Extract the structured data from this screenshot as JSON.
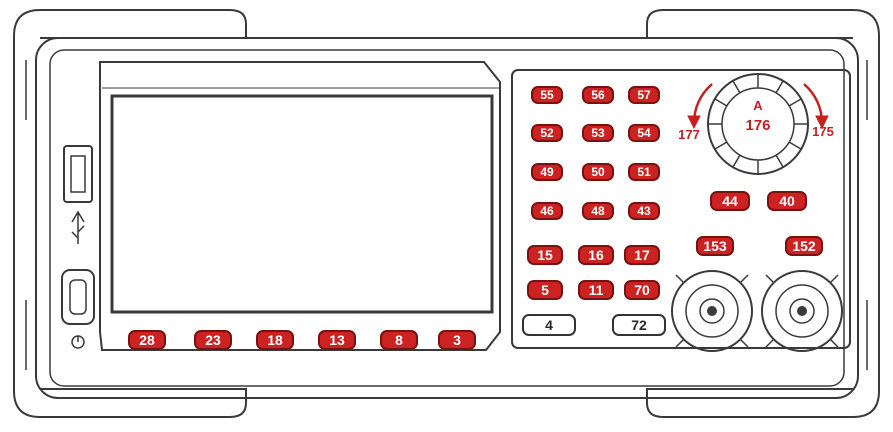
{
  "softkeys": [
    "28",
    "23",
    "18",
    "13",
    "8",
    "3"
  ],
  "keypad": [
    [
      "55",
      "56",
      "57"
    ],
    [
      "52",
      "53",
      "54"
    ],
    [
      "49",
      "50",
      "51"
    ],
    [
      "46",
      "48",
      "43"
    ],
    [
      "15",
      "16",
      "17"
    ],
    [
      "5",
      "11",
      "70"
    ]
  ],
  "bottom_keys": [
    "4",
    "72"
  ],
  "mid_keys": [
    "44",
    "40"
  ],
  "channel_keys": [
    "153",
    "152"
  ],
  "knob": {
    "push": "A",
    "center": "176",
    "left": "177",
    "right": "175"
  },
  "colors": {
    "outline": "#333333",
    "accent": "#c81e1e",
    "key_fill": "#cc2222"
  }
}
